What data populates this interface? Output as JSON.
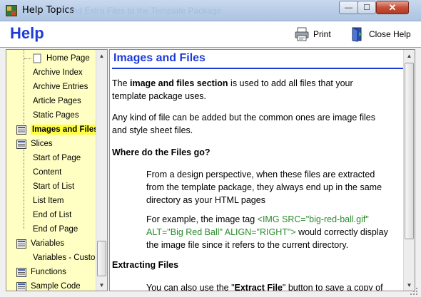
{
  "window": {
    "title": "Help Topics",
    "background_title": "and Extra Files to the Template Package",
    "minimize_label": "—",
    "maximize_label": "☐",
    "close_label": "✕"
  },
  "header": {
    "brand": "Help",
    "print_label": "Print",
    "close_help_label": "Close Help"
  },
  "toc": {
    "items": [
      {
        "label": "Home Page",
        "type": "page",
        "level": 2
      },
      {
        "label": "Archive Index",
        "type": "page",
        "level": 2
      },
      {
        "label": "Archive Entries",
        "type": "page",
        "level": 2
      },
      {
        "label": "Article Pages",
        "type": "page",
        "level": 2
      },
      {
        "label": "Static Pages",
        "type": "page",
        "level": 2
      },
      {
        "label": "Images and Files",
        "type": "book",
        "level": 1,
        "selected": true
      },
      {
        "label": "Slices",
        "type": "book",
        "level": 1
      },
      {
        "label": "Start of Page",
        "type": "page",
        "level": 2
      },
      {
        "label": "Content",
        "type": "page",
        "level": 2
      },
      {
        "label": "Start of List",
        "type": "page",
        "level": 2
      },
      {
        "label": "List Item",
        "type": "page",
        "level": 2
      },
      {
        "label": "End of List",
        "type": "page",
        "level": 2
      },
      {
        "label": "End of Page",
        "type": "page",
        "level": 2
      },
      {
        "label": "Variables",
        "type": "book",
        "level": 1
      },
      {
        "label": "Variables - Custom",
        "type": "page",
        "level": 2
      },
      {
        "label": "Functions",
        "type": "book",
        "level": 1
      },
      {
        "label": "Sample Code",
        "type": "book",
        "level": 1
      }
    ]
  },
  "content": {
    "title": "Images and Files",
    "p1_pre": "The ",
    "p1_bold": "image and files section",
    "p1_line1_post": " is used to add all files that your",
    "p1_line2": "template package uses.",
    "p2_line1": "Any kind of file can be added but the common ones are image files",
    "p2_line2": "and style sheet files.",
    "h1": "Where do the Files go?",
    "p3_line1": "From a design perspective, when these files are extracted",
    "p3_line2": "from the template package, they always end up in the same",
    "p3_line3": "directory as your HTML pages",
    "p4_pre": "For example, the image tag ",
    "p4_code1": "<IMG SRC=\"big-red-ball.gif\"",
    "p4_code2": "ALT=\"Big Red Ball\" ALIGN=\"RIGHT\">",
    "p4_post2": " would correctly display",
    "p4_line3": "the image file since it refers to the current directory.",
    "h2": "Extracting Files",
    "p5_pre": "You can also use the \"",
    "p5_bold": "Extract File",
    "p5_post": "\" button to save a copy of"
  },
  "colors": {
    "accent": "#1c3bd9",
    "toc_background": "#ffffc4",
    "selection": "#ffff40",
    "code_green": "#2a8a2a"
  }
}
